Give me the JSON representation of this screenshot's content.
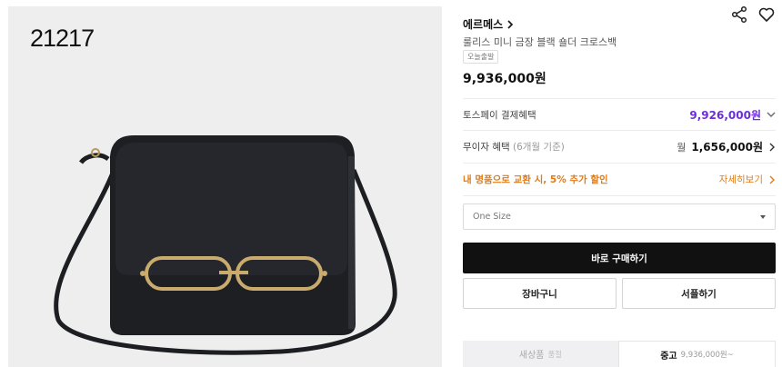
{
  "photo": {
    "code_label": "21217",
    "alt": "roulis mini black bag"
  },
  "header": {
    "share_icon": "share-icon",
    "heart_icon": "heart-icon"
  },
  "product": {
    "brand": "에르메스",
    "title": "룰리스 미니 금장 블랙 숄더 크로스백",
    "badge": "오늘출발",
    "price": "9,936,000원"
  },
  "benefits": {
    "tosspay_label": "토스페이 결제혜택",
    "tosspay_value": "9,926,000원",
    "installment_label": "무이자 혜택",
    "installment_note": "(6개월 기준)",
    "installment_prefix": "월",
    "installment_value": "1,656,000원",
    "trade_label": "내 명품으로 교환 시, 5% 추가 할인",
    "trade_link": "자세히보기"
  },
  "option": {
    "selected": "One Size"
  },
  "actions": {
    "buy_now": "바로 구매하기",
    "cart": "장바구니",
    "showroom": "서플하기"
  },
  "condition_tabs": {
    "new_label": "새상품",
    "new_sub": "품절",
    "used_label": "중고",
    "used_sub": "9,936,000원~"
  },
  "colors": {
    "accent_purple": "#6b2fd9",
    "accent_orange": "#e07b17",
    "primary_button": "#111111"
  }
}
